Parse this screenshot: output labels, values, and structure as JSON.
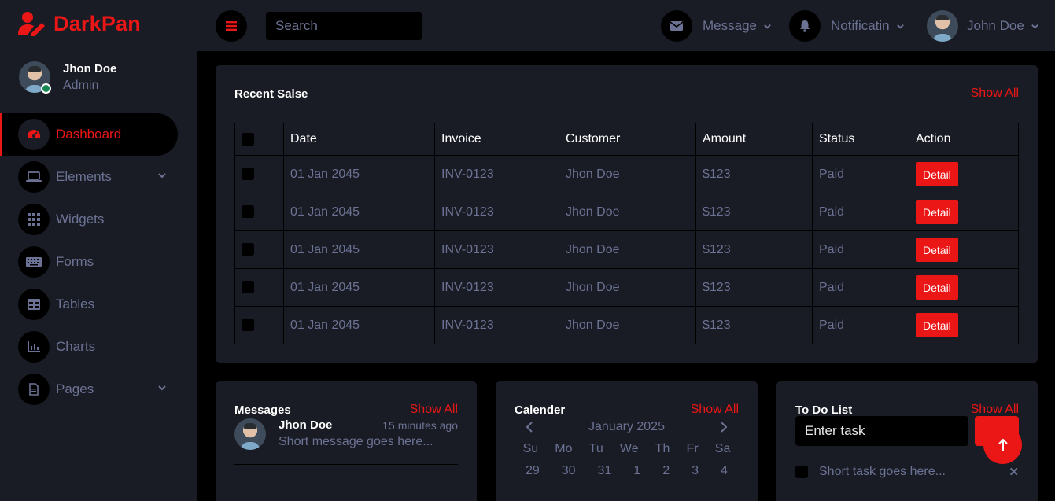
{
  "brand": {
    "name": "DarkPan",
    "icon": "user-edit-icon",
    "color": "#eb1616"
  },
  "profile": {
    "name": "Jhon Doe",
    "role": "Admin",
    "status_color": "#198754"
  },
  "sidebar": {
    "items": [
      {
        "label": "Dashboard",
        "icon": "dashboard-gauge-icon",
        "active": true
      },
      {
        "label": "Elements",
        "icon": "laptop-icon",
        "has_submenu": true
      },
      {
        "label": "Widgets",
        "icon": "grid-icon"
      },
      {
        "label": "Forms",
        "icon": "keyboard-icon"
      },
      {
        "label": "Tables",
        "icon": "table-icon"
      },
      {
        "label": "Charts",
        "icon": "bar-chart-icon"
      },
      {
        "label": "Pages",
        "icon": "file-icon",
        "has_submenu": true
      }
    ]
  },
  "topbar": {
    "search_placeholder": "Search",
    "message_label": "Message",
    "notification_label": "Notificatin",
    "user_name": "John Doe"
  },
  "recent_sales": {
    "title": "Recent Salse",
    "show_all": "Show All",
    "columns": [
      "Date",
      "Invoice",
      "Customer",
      "Amount",
      "Status",
      "Action"
    ],
    "rows": [
      {
        "date": "01 Jan 2045",
        "invoice": "INV-0123",
        "customer": "Jhon Doe",
        "amount": "$123",
        "status": "Paid",
        "action": "Detail"
      },
      {
        "date": "01 Jan 2045",
        "invoice": "INV-0123",
        "customer": "Jhon Doe",
        "amount": "$123",
        "status": "Paid",
        "action": "Detail"
      },
      {
        "date": "01 Jan 2045",
        "invoice": "INV-0123",
        "customer": "Jhon Doe",
        "amount": "$123",
        "status": "Paid",
        "action": "Detail"
      },
      {
        "date": "01 Jan 2045",
        "invoice": "INV-0123",
        "customer": "Jhon Doe",
        "amount": "$123",
        "status": "Paid",
        "action": "Detail"
      },
      {
        "date": "01 Jan 2045",
        "invoice": "INV-0123",
        "customer": "Jhon Doe",
        "amount": "$123",
        "status": "Paid",
        "action": "Detail"
      }
    ]
  },
  "messages": {
    "title": "Messages",
    "show_all": "Show All",
    "items": [
      {
        "name": "Jhon Doe",
        "time": "15 minutes ago",
        "text": "Short message goes here..."
      }
    ]
  },
  "calendar": {
    "title": "Calender",
    "show_all": "Show All",
    "month": "January 2025",
    "days": [
      "Su",
      "Mo",
      "Tu",
      "We",
      "Th",
      "Fr",
      "Sa"
    ],
    "first_row": [
      "29",
      "30",
      "31",
      "1",
      "2",
      "3",
      "4"
    ]
  },
  "todo": {
    "title": "To Do List",
    "show_all": "Show All",
    "input_placeholder": "Enter task",
    "items": [
      {
        "text": "Short task goes here..."
      }
    ]
  },
  "colors": {
    "accent": "#eb1616",
    "panel": "#191c24",
    "muted": "#6c7293"
  }
}
